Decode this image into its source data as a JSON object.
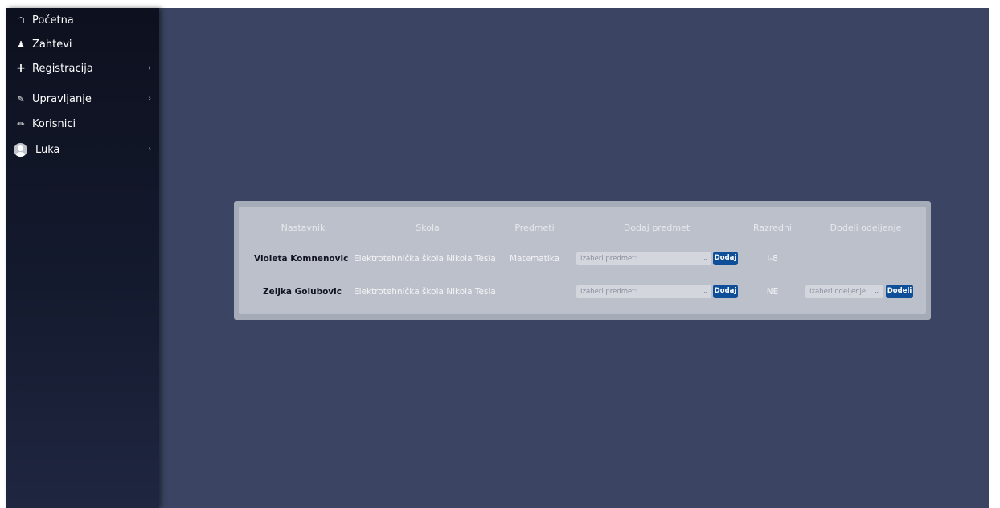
{
  "sidebar": {
    "items": [
      {
        "label": "Početna",
        "icon": "home-icon"
      },
      {
        "label": "Zahtevi",
        "icon": "users-icon"
      },
      {
        "label": "Registracija",
        "icon": "plus-icon",
        "has_submenu": true
      },
      {
        "label": "Upravljanje",
        "icon": "edit-icon",
        "has_submenu": true
      },
      {
        "label": "Korisnici",
        "icon": "pencil-icon"
      },
      {
        "label": "Luka",
        "icon": "user-avatar-icon",
        "has_submenu": true
      }
    ]
  },
  "table": {
    "headers": [
      "Nastavnik",
      "Skola",
      "Predmeti",
      "Dodaj predmet",
      "Razredni",
      "Dodeli odeljenje"
    ],
    "rows": [
      {
        "nastavnik": "Violeta Komnenovic",
        "skola": "Elektrotehnička škola Nikola Tesla",
        "predmeti": "Matematika",
        "select_placeholder": "Izaberi predmet:",
        "add_button": "Dodaj",
        "razredni": "I-8"
      },
      {
        "nastavnik": "Zeljka Golubovic",
        "skola": "Elektrotehnička škola Nikola Tesla",
        "predmeti": "",
        "select_placeholder": "Izaberi predmet:",
        "add_button": "Dodaj",
        "razredni": "NE",
        "assign_select_placeholder": "Izaberi odeljenje:",
        "assign_button": "Dodeli"
      }
    ]
  },
  "colors": {
    "background": "#3b4563",
    "sidebar": "#0d101e",
    "panel": "#bcc0ca",
    "button": "#0f4f99"
  }
}
